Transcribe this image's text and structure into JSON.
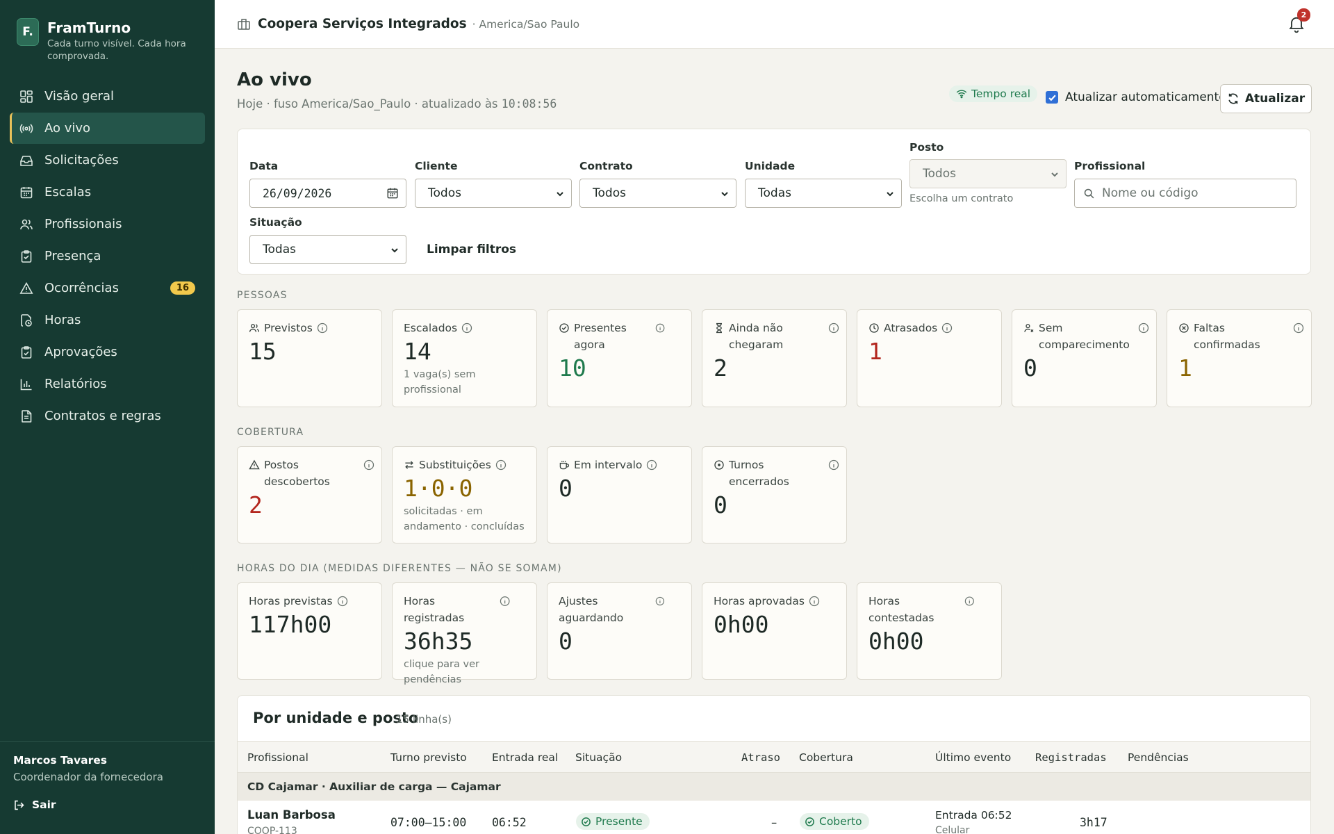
{
  "brand": {
    "logo": "F.",
    "name": "FramTurno",
    "tagline": "Cada turno visível. Cada hora comprovada."
  },
  "nav": [
    {
      "label": "Visão geral",
      "icon": "grid-icon"
    },
    {
      "label": "Ao vivo",
      "icon": "broadcast-icon",
      "active": true
    },
    {
      "label": "Solicitações",
      "icon": "inbox-icon"
    },
    {
      "label": "Escalas",
      "icon": "calendar-icon"
    },
    {
      "label": "Profissionais",
      "icon": "users-icon"
    },
    {
      "label": "Presença",
      "icon": "clipboard-check-icon"
    },
    {
      "label": "Ocorrências",
      "icon": "alert-icon",
      "badge": "16"
    },
    {
      "label": "Horas",
      "icon": "file-clock-icon"
    },
    {
      "label": "Aprovações",
      "icon": "clipboard-approve-icon"
    },
    {
      "label": "Relatórios",
      "icon": "bar-chart-icon"
    },
    {
      "label": "Contratos e regras",
      "icon": "document-icon"
    }
  ],
  "user": {
    "name": "Marcos Tavares",
    "role": "Coordenador da fornecedora",
    "logout": "Sair"
  },
  "topbar": {
    "org": "Coopera Serviços Integrados",
    "timezone": "· America/Sao Paulo",
    "notifications": "2"
  },
  "header": {
    "title": "Ao vivo",
    "subtitle": "Hoje · fuso America/Sao_Paulo · atualizado às ",
    "updated_time": "10:08:56",
    "live_label": "Tempo real",
    "auto_label": "Atualizar automaticamente",
    "auto_checked": true,
    "refresh_label": "Atualizar"
  },
  "filters": {
    "data": {
      "label": "Data",
      "value": "26/09/2026"
    },
    "cliente": {
      "label": "Cliente",
      "value": "Todos"
    },
    "contrato": {
      "label": "Contrato",
      "value": "Todos"
    },
    "unidade": {
      "label": "Unidade",
      "value": "Todas"
    },
    "posto": {
      "label": "Posto",
      "value": "Todos",
      "help": "Escolha um contrato"
    },
    "profissional": {
      "label": "Profissional",
      "placeholder": "Nome ou código"
    },
    "situacao": {
      "label": "Situação",
      "value": "Todas"
    },
    "clear_label": "Limpar filtros"
  },
  "sections": {
    "pessoas": "PESSOAS",
    "cobertura": "COBERTURA",
    "horas": "HORAS DO DIA (MEDIDAS DIFERENTES — NÃO SE SOMAM)"
  },
  "pessoas": [
    {
      "label": "Previstos",
      "value": "15",
      "icon": "users-icon"
    },
    {
      "label": "Escalados",
      "value": "14",
      "note": "1 vaga(s) sem profissional"
    },
    {
      "label": "Presentes agora",
      "value": "10",
      "icon": "check-circle-icon",
      "tone": "green"
    },
    {
      "label": "Ainda não chegaram",
      "value": "2",
      "icon": "hourglass-icon"
    },
    {
      "label": "Atrasados",
      "value": "1",
      "icon": "clock-icon",
      "tone": "red"
    },
    {
      "label": "Sem comparecimento",
      "value": "0",
      "icon": "user-x-icon"
    },
    {
      "label": "Faltas confirmadas",
      "value": "1",
      "icon": "x-circle-icon",
      "tone": "amber"
    }
  ],
  "cobertura": [
    {
      "label": "Postos descobertos",
      "value": "2",
      "icon": "alert-icon",
      "tone": "red"
    },
    {
      "label": "Substituições",
      "value": "1·0·0",
      "icon": "swap-icon",
      "tone": "amber",
      "note": "solicitadas · em andamento · concluídas"
    },
    {
      "label": "Em intervalo",
      "value": "0",
      "icon": "coffee-icon"
    },
    {
      "label": "Turnos encerrados",
      "value": "0",
      "icon": "stop-circle-icon"
    }
  ],
  "horas": [
    {
      "label": "Horas previstas",
      "value": "117h00"
    },
    {
      "label": "Horas registradas",
      "value": "36h35",
      "note": "clique para ver pendências"
    },
    {
      "label": "Ajustes aguardando",
      "value": "0"
    },
    {
      "label": "Horas aprovadas",
      "value": "0h00"
    },
    {
      "label": "Horas contestadas",
      "value": "0h00"
    }
  ],
  "table": {
    "title": "Por unidade e posto",
    "count": "15 linha(s)",
    "columns": [
      "Profissional",
      "Turno previsto",
      "Entrada real",
      "Situação",
      "Atraso",
      "Cobertura",
      "Último evento",
      "Registradas",
      "Pendências"
    ],
    "group": "CD Cajamar · Auxiliar de carga — Cajamar",
    "rows": [
      {
        "name": "Luan Barbosa",
        "code": "COOP-113",
        "shift": "07:00–15:00",
        "entry": "06:52",
        "status": "Presente",
        "delay": "–",
        "coverage": "Coberto",
        "last_event": "Entrada 06:52",
        "last_event_source": "Celular",
        "registered": "3h17",
        "pending": ""
      }
    ]
  },
  "colors": {
    "sidebar": "#163a32",
    "accent": "#e8c15a",
    "green": "#1f7a4d",
    "red": "#b3261e",
    "amber": "#8a6400"
  }
}
